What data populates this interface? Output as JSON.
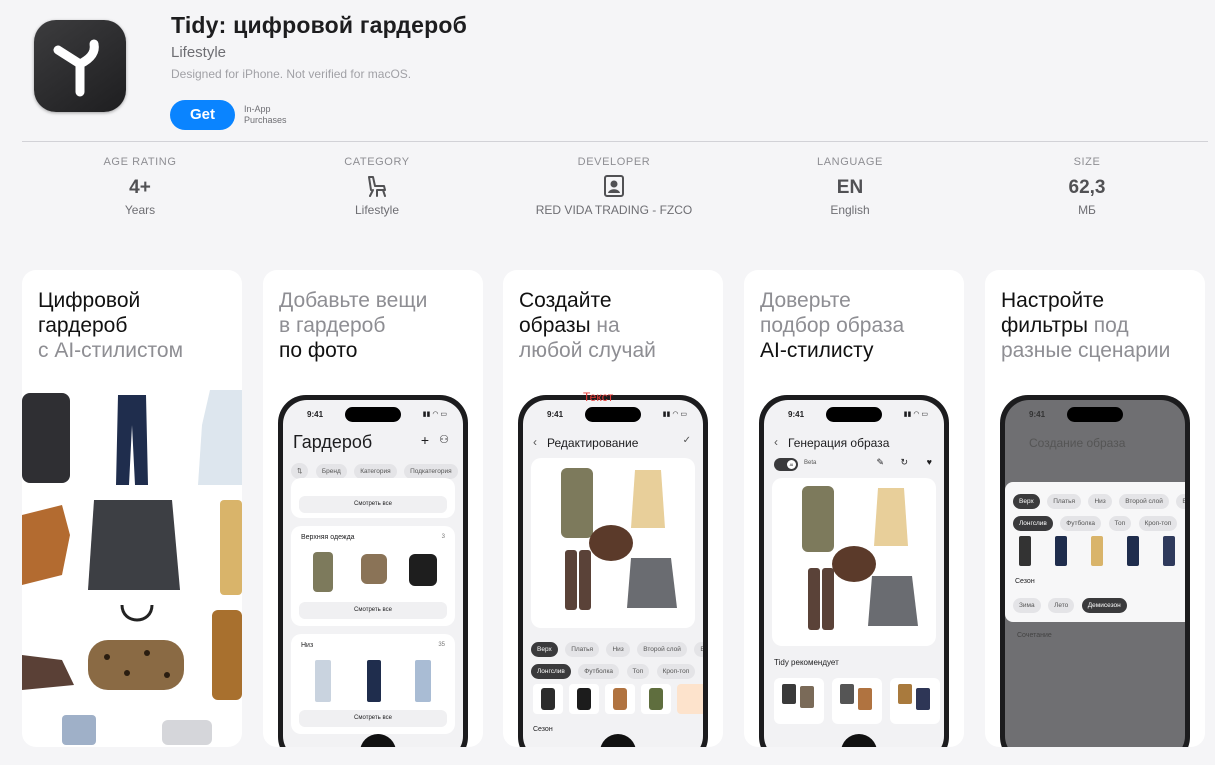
{
  "app": {
    "title": "Tidy: цифровой гардероб",
    "category": "Lifestyle",
    "designed_for": "Designed for iPhone. Not verified for macOS.",
    "get_label": "Get",
    "in_app": "In-App",
    "purchases": "Purchases",
    "icon": "tidy-app-icon"
  },
  "info": {
    "age": {
      "label": "AGE RATING",
      "value": "4+",
      "sub": "Years"
    },
    "category": {
      "label": "CATEGORY",
      "icon": "chair-icon",
      "sub": "Lifestyle"
    },
    "developer": {
      "label": "DEVELOPER",
      "icon": "person-card-icon",
      "sub": "RED VIDA TRADING - FZCO"
    },
    "language": {
      "label": "LANGUAGE",
      "value": "EN",
      "sub": "English"
    },
    "size": {
      "label": "SIZE",
      "value": "62,3",
      "sub": "МБ"
    }
  },
  "cards": {
    "c1": {
      "l1": "Цифровой",
      "l2": "гардероб",
      "l3": "с AI-стилистом"
    },
    "c2": {
      "l1": "Добавьте вещи",
      "l2": "в гардероб",
      "l3": "по фото",
      "time": "9:41",
      "title": "Гардероб",
      "chips": [
        "Бренд",
        "Категория",
        "Подкатегория"
      ],
      "see_all": "Смотреть все",
      "outerwear": "Верхняя одежда",
      "outerwear_count": "3",
      "bottoms": "Низ",
      "bottoms_count": "35"
    },
    "c3": {
      "l1": "Создайте",
      "l2a": "образы",
      "l2b": " на",
      "l3": "любой случай",
      "time": "9:41",
      "title": "Редактирование",
      "overlay": "Текст",
      "chips1": [
        "Верх",
        "Платья",
        "Низ",
        "Второй слой",
        "Ве"
      ],
      "chips2": [
        "Лонгслив",
        "Футболка",
        "Топ",
        "Кроп-топ",
        "Б"
      ],
      "season": "Сезон"
    },
    "c4": {
      "l1": "Доверьте",
      "l2": "подбор образа",
      "l3": "AI-стилисту",
      "time": "9:41",
      "title": "Генерация образа",
      "toggle": "AI",
      "beta": "Beta",
      "recommends": "Tidy рекомендует"
    },
    "c5": {
      "l1": "Настройте",
      "l2a": "фильтры",
      "l2b": " под",
      "l3": "разные сценарии",
      "time": "9:41",
      "title": "Создание образа",
      "chips1": [
        "Верх",
        "Платья",
        "Низ",
        "Второй слой",
        "Ве"
      ],
      "chips2": [
        "Лонгслив",
        "Футболка",
        "Топ",
        "Кроп-топ"
      ],
      "season": "Сезон",
      "seasons": [
        "Зима",
        "Лето",
        "Демисезон"
      ],
      "below": "Сочетание"
    }
  }
}
